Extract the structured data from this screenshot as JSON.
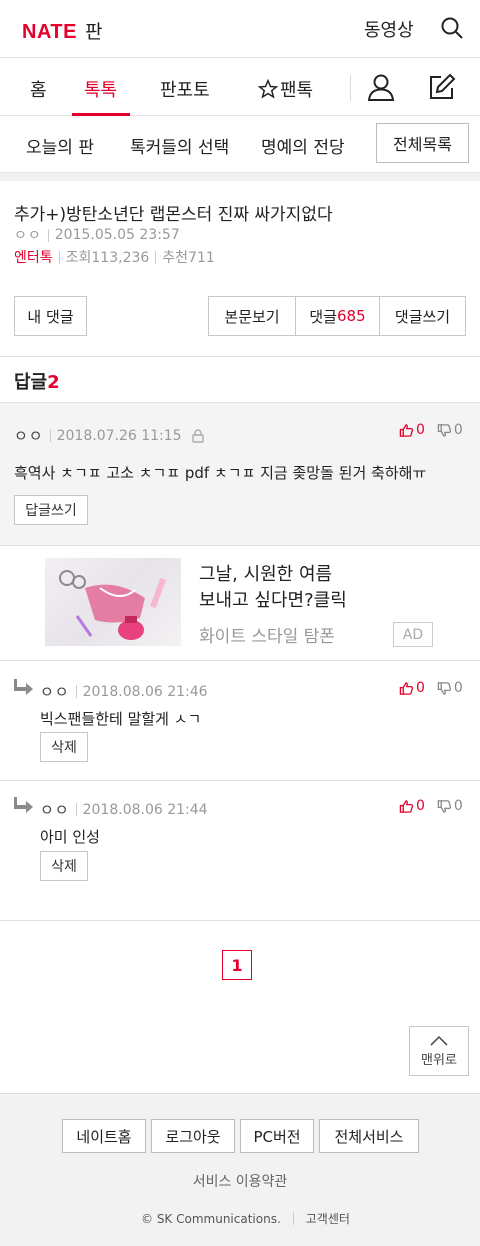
{
  "header": {
    "logo_brand": "NATE",
    "logo_section": "판",
    "video_label": "동영상",
    "search_icon": "search-icon"
  },
  "tabs": {
    "home": "홈",
    "toktok": "톡톡",
    "panphoto": "판포토",
    "fantok": "팬톡",
    "fantok_icon": "star-outline-icon",
    "user_icon": "user-icon",
    "write_icon": "edit-icon",
    "active_color": "#e4002b"
  },
  "subtabs": {
    "today": "오늘의 판",
    "talkers_choice": "톡커들의 선택",
    "hall_of_fame": "명예의 전당",
    "all_list": "전체목록"
  },
  "article": {
    "title": "추가+)방탄소년단 랩몬스터 진짜 싸가지없다",
    "author": "ㅇㅇ",
    "datetime": "2015.05.05 23:57",
    "category": "엔터톡",
    "views_label": "조회113,236",
    "recommend_label": "추천711"
  },
  "actions": {
    "my_comments": "내 댓글",
    "view_body": "본문보기",
    "comments_label": "댓글",
    "comments_count": "685",
    "write_comment": "댓글쓰기"
  },
  "replies": {
    "heading": "답글",
    "count": "2"
  },
  "comment": {
    "author": "ㅇㅇ",
    "datetime": "2018.07.26 11:15",
    "text": "흑역사 ㅊㄱㅍ 고소 ㅊㄱㅍ pdf ㅊㄱㅍ 지금 좆망돌 된거 축하해ㅠ",
    "reply_button": "답글쓰기",
    "up": "0",
    "down": "0",
    "lock_icon": "lock-icon"
  },
  "ad": {
    "line1": "그날, 시원한 여름",
    "line2": "보내고 싶다면?클릭",
    "sponsor": "화이트 스타일 탐폰",
    "badge": "AD"
  },
  "reply_items": [
    {
      "author": "ㅇㅇ",
      "datetime": "2018.08.06 21:46",
      "text": "빅스팬들한테 말할게 ㅅㄱ",
      "delete": "삭제",
      "up": "0",
      "down": "0"
    },
    {
      "author": "ㅇㅇ",
      "datetime": "2018.08.06 21:44",
      "text": "아미 인성",
      "delete": "삭제",
      "up": "0",
      "down": "0"
    }
  ],
  "pagination": {
    "current": "1"
  },
  "back_to_top": "맨위로",
  "footer": {
    "nate_home": "네이트홈",
    "logout": "로그아웃",
    "pc_version": "PC버전",
    "all_services": "전체서비스",
    "terms": "서비스 이용약관",
    "copyright": "© SK Communications.",
    "support": "고객센터"
  }
}
